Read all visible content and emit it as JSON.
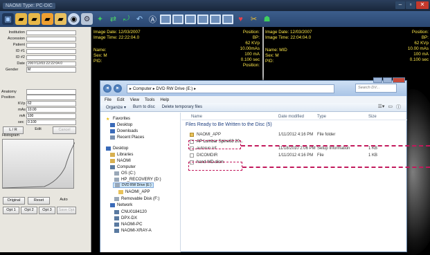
{
  "app": {
    "title": "NAOMI Type: PC-DIC",
    "window_controls": [
      "–",
      "▫",
      "✕"
    ]
  },
  "left_panel": {
    "fields": [
      {
        "label": "Institution",
        "value": ""
      },
      {
        "label": "Accession",
        "value": ""
      },
      {
        "label": "Patient",
        "value": ""
      },
      {
        "label": "ID #1",
        "value": ""
      },
      {
        "label": "ID #2",
        "value": ""
      },
      {
        "label": "Date",
        "value": "2007/12/03 22:22:04.0"
      }
    ],
    "gender_label": "Gender",
    "gender_value": "M",
    "anatomy_label": "Anatomy",
    "position_label": "Position",
    "kvp_label": "KVp",
    "kvp_value": "62",
    "mas_label": "mAs",
    "mas_value": "10.00",
    "ma_label": "mA",
    "ma_value": "100",
    "sec_label": "sec",
    "sec_value": "0.100",
    "lr_button": "L / R",
    "edit_button": "Edit",
    "cancel_button": "Cancel",
    "histogram_label": "Histogram",
    "original_button": "Original",
    "reset_button": "Reset",
    "auto_button": "Auto",
    "opt1": "Opt 1",
    "opt2": "Opt 2",
    "opt3": "Opt 3",
    "save_opt": "Save Opt"
  },
  "viewport1": {
    "image_date": "Image Date: 12/03/2007",
    "image_time": "Image Time: 22:22:04.0",
    "position": "Position:",
    "bp": "BP:",
    "kvp": "62 KVp",
    "name": "Name:",
    "sex": "Sex: M",
    "pid": "PID:",
    "mas": "10.00mAs",
    "ma": "100 mA",
    "sec": "0.100 sec",
    "position2": "Position:"
  },
  "viewport2": {
    "image_date": "Image Date: 12/03/2007",
    "image_time": "Image Time: 22:04:04.0",
    "position": "Position:",
    "bp": "BP:",
    "kvp": "62 KVp",
    "name": "Name: MID",
    "sex": "Sex: M",
    "pid": "PID:",
    "mas": "10.00 mAs",
    "ma": "100 mA",
    "sec": "0.100 sec"
  },
  "explorer": {
    "breadcrumb": "▸ Computer ▸ DVD RW Drive (E:) ▸",
    "search_placeholder": "Search DV...",
    "menu": [
      "File",
      "Edit",
      "View",
      "Tools",
      "Help"
    ],
    "commands": [
      "Organize ▾",
      "Burn to disc",
      "Delete temporary files"
    ],
    "nav": {
      "favorites": "Favorites",
      "desktop": "Desktop",
      "downloads": "Downloads",
      "recent": "Recent Places",
      "desktop2": "Desktop",
      "libraries": "Libraries",
      "naomi": "NAOMI",
      "computer": "Computer",
      "os": "OS (C:)",
      "hp": "HP_RECOVERY (D:)",
      "dvd": "DVD RW Drive (E:)",
      "naomi_app": "NAOMI_APP",
      "removable": "Removable Disk (F:)",
      "network": "Network",
      "n1": "CNU0184120",
      "n2": "DPX-DX",
      "n3": "NAOMI-PC",
      "n4": "NAOMI-XRAY-A"
    },
    "columns": {
      "name": "Name",
      "date": "Date modified",
      "type": "Type",
      "size": "Size"
    },
    "group": "Files Ready to Be Written to the Disc (5)",
    "rows": [
      {
        "name": "NAOMI_APP",
        "date": "1/11/2012 4:16 PM",
        "type": "File folder",
        "size": ""
      },
      {
        "name": "AP Lumbar Spine68 20...",
        "date": "",
        "type": "",
        "size": ""
      },
      {
        "name": "autorun.inf",
        "date": "11/18/2010 2:06 PM",
        "type": "Setup Information",
        "size": "1 KB"
      },
      {
        "name": "DICOMDIR",
        "date": "1/11/2012 4:16 PM",
        "type": "File",
        "size": "1 KB"
      },
      {
        "name": "hand-MD.dicm",
        "date": "",
        "type": "",
        "size": ""
      }
    ]
  },
  "colors": {
    "accent": "#c2185b",
    "overlay_text": "#ffe94a"
  }
}
